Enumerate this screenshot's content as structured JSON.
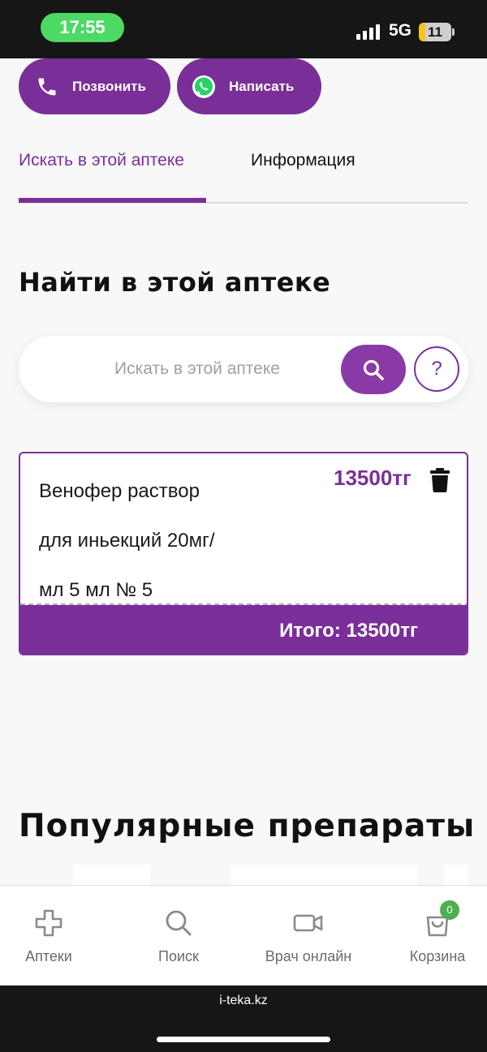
{
  "status": {
    "time": "17:55",
    "network": "5G",
    "battery": "11"
  },
  "actions": {
    "call_label": "Позвонить",
    "write_label": "Написать"
  },
  "tabs": [
    {
      "label": "Искать в этой аптеке"
    },
    {
      "label": "Информация"
    }
  ],
  "section_title": "Найти в этой аптеке",
  "search": {
    "placeholder": "Искать в этой аптеке",
    "help_label": "?"
  },
  "cart": {
    "item_lines": [
      "Венофер раствор",
      "для иньекций 20мг/",
      "мл 5 мл № 5"
    ],
    "item_price": "13500тг",
    "total": "Итого: 13500тг"
  },
  "popular_title": "Популярные препараты",
  "nav": [
    {
      "label": "Аптеки",
      "icon": "plus-icon"
    },
    {
      "label": "Поиск",
      "icon": "search-icon"
    },
    {
      "label": "Врач онлайн",
      "icon": "video-camera-icon"
    },
    {
      "label": "Корзина",
      "icon": "shopping-bag-icon",
      "badge": "0"
    }
  ],
  "browser": {
    "url": "i-teka.kz"
  },
  "colors": {
    "accent": "#7a2f98",
    "status_green": "#4cd964",
    "badge_green": "#4caf50"
  }
}
